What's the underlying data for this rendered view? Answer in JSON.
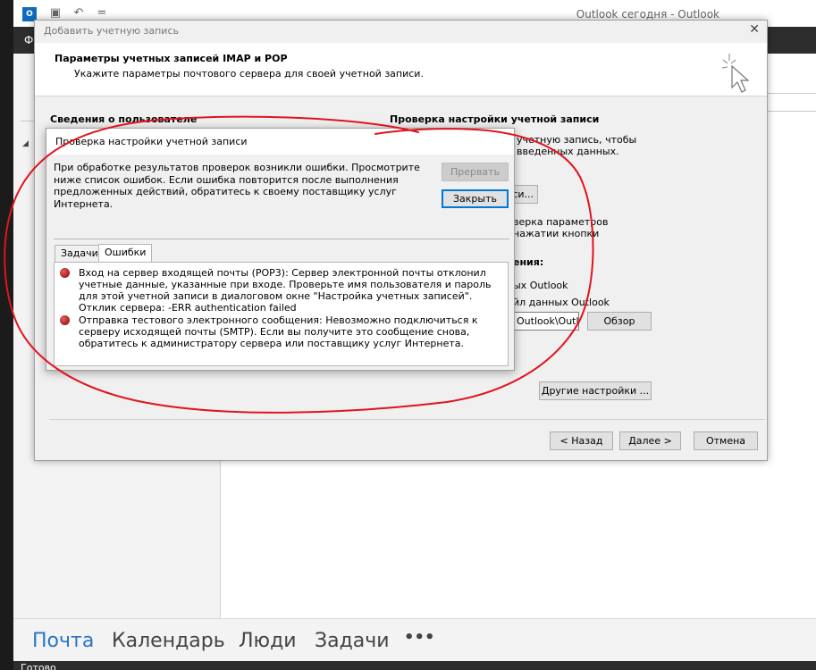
{
  "app": {
    "title_bar": "Outlook сегодня - Outlook",
    "icon_text": "O",
    "ribbon_file": "Ф"
  },
  "bottom_nav": {
    "items": [
      "Почта",
      "Календарь",
      "Люди",
      "Задачи"
    ],
    "more": "•••"
  },
  "status": {
    "text": "Готово"
  },
  "dialog": {
    "title": "Добавить учетную запись",
    "header_title": "Параметры учетных записей IMAP и POP",
    "header_subtitle": "Укажите параметры почтового сервера для своей учетной записи.",
    "left_section": "Сведения о пользователе",
    "right_section": "Проверка настройки учетной записи",
    "fragments": {
      "f1": "учетную запись, чтобы",
      "f2": "введенных данных.",
      "f3_btn": "си...",
      "f4": "верка параметров",
      "f5": "нажатии кнопки",
      "f6": "ения:",
      "f7": "ых Outlook",
      "f8": "йл данных Outlook"
    },
    "path_value": "Outlook\\Outl",
    "browse_button": "Обзор",
    "more_settings_button": "Другие настройки ...",
    "back_button": "< Назад",
    "next_button": "Далее >",
    "cancel_button": "Отмена"
  },
  "test_dialog": {
    "title": "Проверка настройки учетной записи",
    "message": "При обработке результатов проверок возникли ошибки. Просмотрите ниже список ошибок. Если ошибка повторится после выполнения предложенных действий, обратитесь к своему поставщику услуг Интернета.",
    "stop_button": "Прервать",
    "close_button": "Закрыть",
    "tabs": [
      "Задачи",
      "Ошибки"
    ],
    "errors": [
      "Вход на сервер входящей почты (POP3): Сервер электронной почты отклонил учетные данные, указанные при входе. Проверьте имя пользователя и пароль для этой учетной записи в диалоговом окне \"Настройка учетных записей\".  Отклик сервера: -ERR authentication failed",
      "Отправка тестового электронного сообщения: Невозможно подключиться к серверу исходящей почты (SMTP). Если вы получите это сообщение снова, обратитесь к администратору сервера или поставщику услуг Интернета."
    ]
  },
  "colors": {
    "accent": "#2b74c7",
    "annotation": "#e0141e",
    "error": "#a00000"
  }
}
